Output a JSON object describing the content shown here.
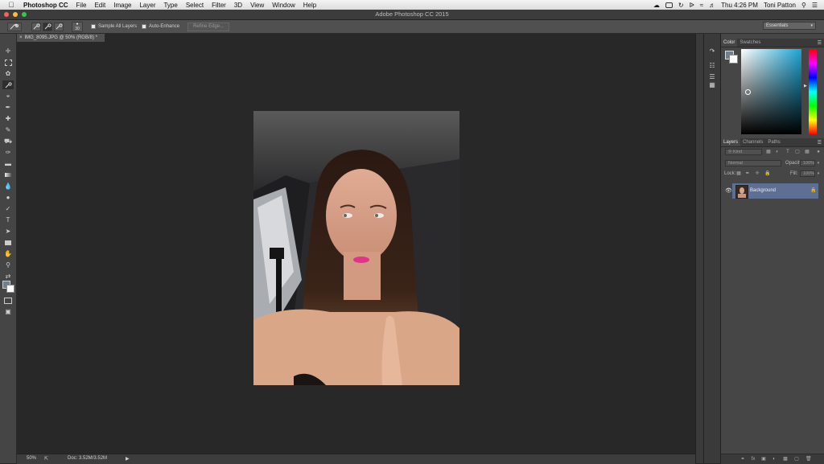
{
  "menubar": {
    "app_name": "Photoshop CC",
    "items": [
      "File",
      "Edit",
      "Image",
      "Layer",
      "Type",
      "Select",
      "Filter",
      "3D",
      "View",
      "Window",
      "Help"
    ],
    "clock": "Thu 4:26 PM",
    "user": "Toni Patton"
  },
  "window": {
    "title": "Adobe Photoshop CC 2015"
  },
  "options": {
    "brush_size": "30",
    "sample_all_layers": "Sample All Layers",
    "auto_enhance": "Auto-Enhance",
    "refine_edge": "Refine Edge...",
    "workspace": "Essentials"
  },
  "document": {
    "tab_label": "IMG_8095.JPG @ 50% (RGB/8) *",
    "zoom": "50%",
    "doc_size": "Doc: 3.52M/3.52M"
  },
  "color_panel": {
    "tabs": [
      "Color",
      "Swatches"
    ]
  },
  "layers_panel": {
    "tabs": [
      "Layers",
      "Channels",
      "Paths"
    ],
    "filter_kind": "Kind",
    "blend_mode": "Normal",
    "opacity_label": "Opacity:",
    "opacity_value": "100%",
    "lock_label": "Lock:",
    "fill_label": "Fill:",
    "fill_value": "100%",
    "layer_name": "Background"
  },
  "colors": {
    "accent_selection": "#5e6f94"
  }
}
